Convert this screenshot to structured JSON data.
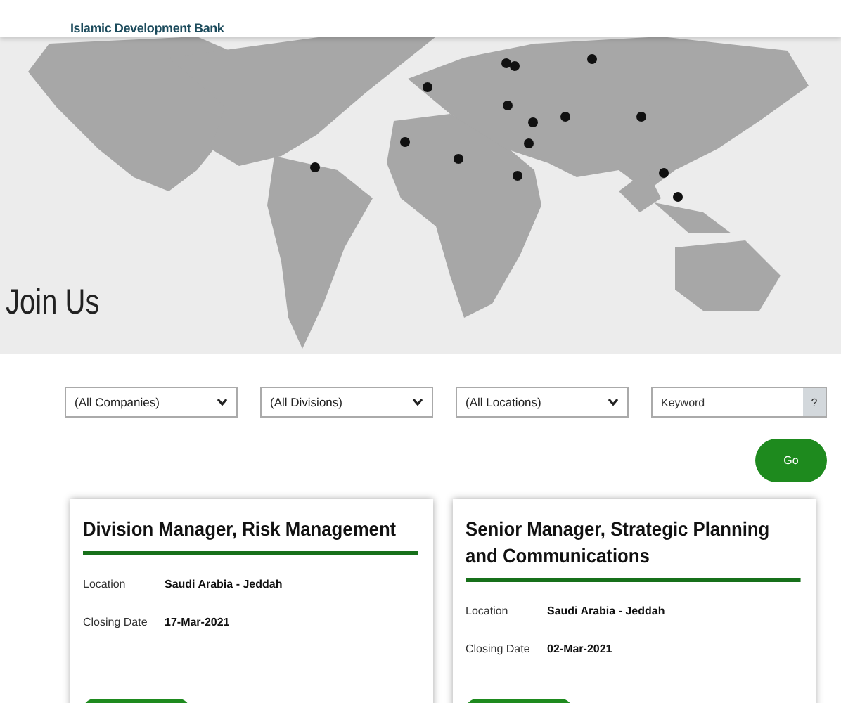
{
  "header": {
    "logo_text": "Islamic Development Bank"
  },
  "hero": {
    "title": "Join Us"
  },
  "filters": [
    {
      "kind": "select",
      "value": "(All Companies)"
    },
    {
      "kind": "select",
      "value": "(All Divisions)"
    },
    {
      "kind": "select",
      "value": "(All Locations)"
    },
    {
      "kind": "search",
      "placeholder": "Keyword",
      "help": "?"
    }
  ],
  "go_button": "Go",
  "jobs": [
    {
      "title": "Division Manager, Risk Management",
      "fields": [
        {
          "label": "Location",
          "value": "Saudi Arabia - Jeddah"
        },
        {
          "label": "Closing Date",
          "value": "17-Mar-2021"
        }
      ]
    },
    {
      "title": "Senior Manager, Strategic Planning and Communications",
      "fields": [
        {
          "label": "Location",
          "value": "Saudi Arabia - Jeddah"
        },
        {
          "label": "Closing Date",
          "value": "02-Mar-2021"
        }
      ]
    }
  ]
}
